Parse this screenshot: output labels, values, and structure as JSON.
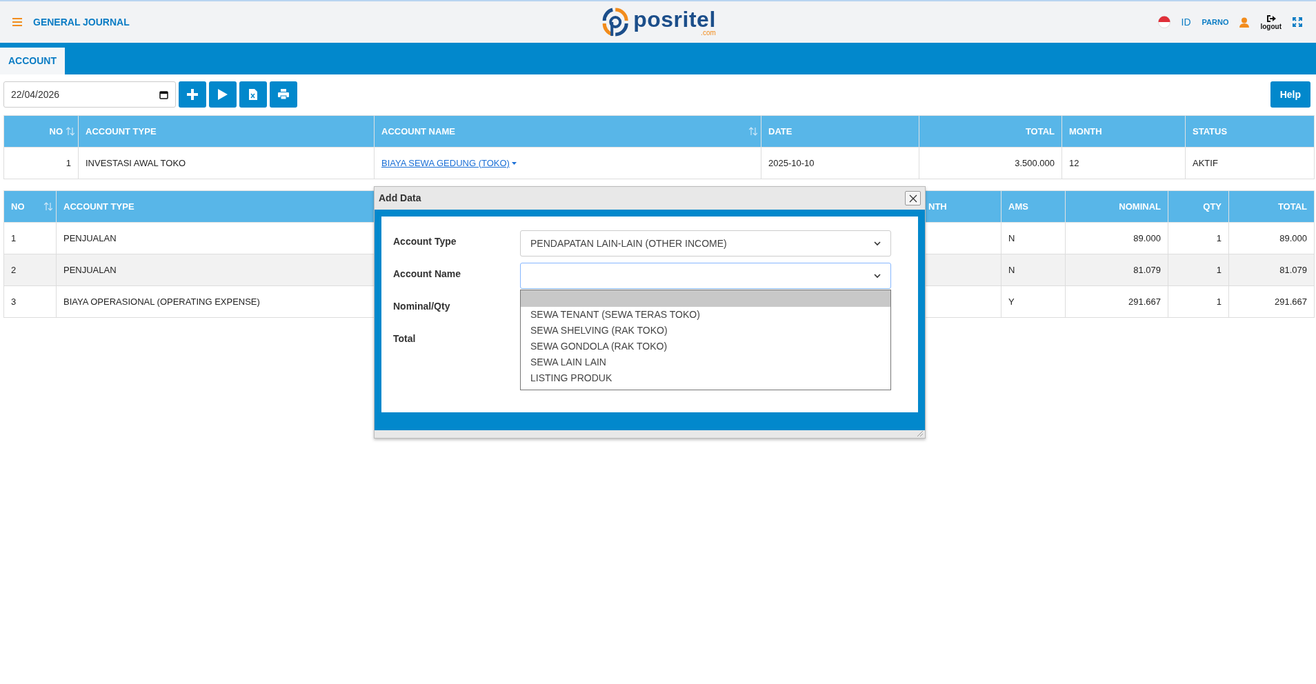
{
  "header": {
    "title": "GENERAL JOURNAL",
    "logo": {
      "name": "posritel",
      "suffix": ".com"
    },
    "language": "ID",
    "user": "PARNO",
    "logout": "logout"
  },
  "tabs": [
    {
      "label": "ACCOUNT",
      "selected": true
    }
  ],
  "toolbar": {
    "date": "22/04/2026",
    "help": "Help"
  },
  "summary_table": {
    "columns": [
      {
        "label": "NO",
        "kind": "number",
        "sortable": true
      },
      {
        "label": "ACCOUNT TYPE",
        "kind": "text",
        "sortable": false
      },
      {
        "label": "ACCOUNT NAME",
        "kind": "link",
        "sortable": true
      },
      {
        "label": "DATE",
        "kind": "text",
        "sortable": false
      },
      {
        "label": "TOTAL",
        "kind": "number",
        "sortable": false
      },
      {
        "label": "MONTH",
        "kind": "text",
        "sortable": false
      },
      {
        "label": "STATUS",
        "kind": "text",
        "sortable": false
      }
    ],
    "rows": [
      [
        "1",
        "INVESTASI AWAL TOKO",
        "BIAYA SEWA GEDUNG (TOKO)",
        "2025-10-10",
        "3.500.000",
        "12",
        "AKTIF"
      ]
    ]
  },
  "detail_table": {
    "columns": [
      {
        "label": "NO",
        "kind": "text",
        "sortable": true
      },
      {
        "label": "ACCOUNT TYPE",
        "kind": "text",
        "sortable": false
      },
      {
        "label": "NTH",
        "kind": "covered",
        "sortable": false
      },
      {
        "label": "AMS",
        "kind": "text",
        "sortable": false
      },
      {
        "label": "NOMINAL",
        "kind": "number",
        "sortable": false
      },
      {
        "label": "QTY",
        "kind": "number",
        "sortable": false
      },
      {
        "label": "TOTAL",
        "kind": "number",
        "sortable": false
      }
    ],
    "rows": [
      [
        "1",
        "PENJUALAN",
        "",
        "N",
        "89.000",
        "1",
        "89.000"
      ],
      [
        "2",
        "PENJUALAN",
        "",
        "N",
        "81.079",
        "1",
        "81.079"
      ],
      [
        "3",
        "BIAYA OPERASIONAL (OPERATING EXPENSE)",
        "",
        "Y",
        "291.667",
        "1",
        "291.667"
      ]
    ]
  },
  "dialog": {
    "title": "Add Data",
    "fields": [
      {
        "label": "Account Type",
        "kind": "select",
        "value": "PENDAPATAN LAIN-LAIN (OTHER INCOME)",
        "focused": false,
        "open": false
      },
      {
        "label": "Account Name",
        "kind": "select",
        "focused": true,
        "open": true,
        "blank_highlighted": true,
        "options": [
          "SEWA TENANT (SEWA TERAS TOKO)",
          "SEWA SHELVING (RAK TOKO)",
          "SEWA GONDOLA (RAK TOKO)",
          "SEWA LAIN LAIN",
          "LISTING PRODUK"
        ]
      },
      {
        "label": "Nominal/Qty",
        "kind": "covered"
      },
      {
        "label": "Total",
        "kind": "covered"
      }
    ]
  }
}
